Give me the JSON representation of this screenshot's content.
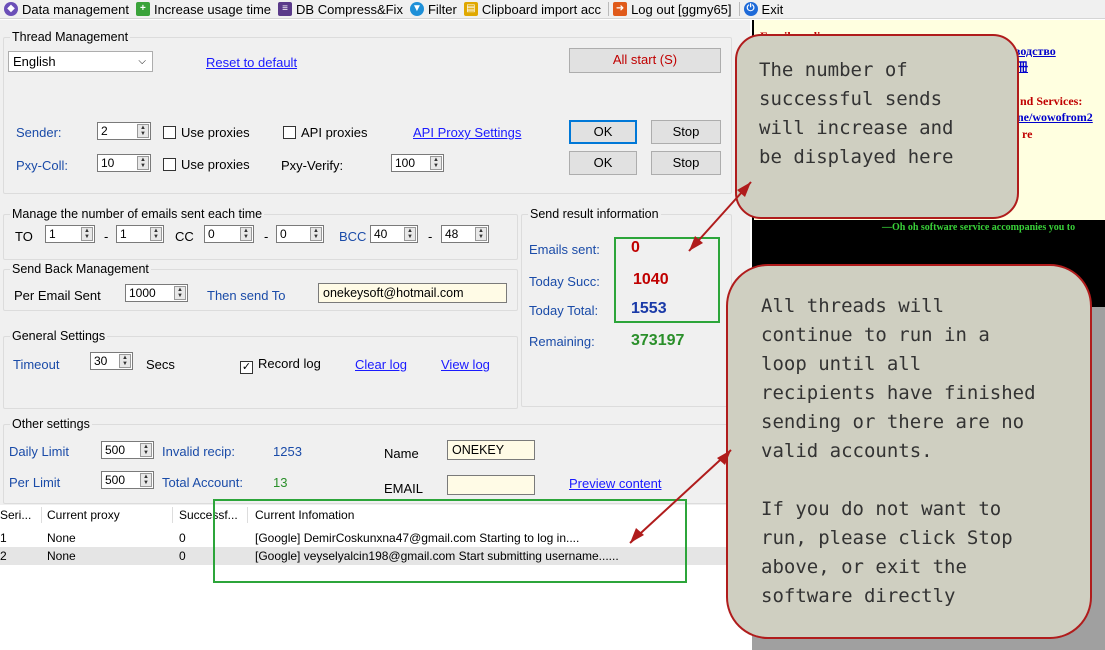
{
  "toolbar": {
    "items": [
      {
        "label": "Data management",
        "icon": "data-management-icon",
        "color": "#6b4fb8"
      },
      {
        "label": "Increase usage time",
        "icon": "add-time-icon",
        "color": "#3aa33a"
      },
      {
        "label": "DB Compress&Fix",
        "icon": "books-icon",
        "color": "#5a3a8a"
      },
      {
        "label": "Filter",
        "icon": "filter-icon",
        "color": "#1e90d8"
      },
      {
        "label": "Clipboard import acc",
        "icon": "clipboard-icon",
        "color": "#e0a800"
      },
      {
        "label": "Log out [ggmy65]",
        "icon": "logout-icon",
        "color": "#e05a1a"
      },
      {
        "label": "Exit",
        "icon": "power-icon",
        "color": "#1e6ad8"
      }
    ]
  },
  "thread": {
    "title": "Thread Management",
    "language": "English",
    "reset": "Reset to default",
    "all_start": "All start (S)",
    "sender_label": "Sender:",
    "sender_value": "2",
    "use_proxies": "Use proxies",
    "api_proxies": "API proxies",
    "api_proxy_settings": "API Proxy Settings",
    "ok": "OK",
    "stop": "Stop",
    "pxy_coll_label": "Pxy-Coll:",
    "pxy_coll_value": "10",
    "pxy_verify_label": "Pxy-Verify:",
    "pxy_verify_value": "100"
  },
  "manage": {
    "title": "Manage the number of emails sent each time",
    "to_label": "TO",
    "to_min": "1",
    "to_max": "1",
    "cc_label": "CC",
    "cc_min": "0",
    "cc_max": "0",
    "bcc_label": "BCC",
    "bcc_min": "40",
    "bcc_max": "48",
    "dash": "-"
  },
  "sendback": {
    "title": "Send Back Management",
    "per_email_label": "Per Email Sent",
    "per_email_value": "1000",
    "then_send": "Then send To",
    "email": "onekeysoft@hotmail.com"
  },
  "general": {
    "title": "General Settings",
    "timeout_label": "Timeout",
    "timeout_value": "30",
    "secs": "Secs",
    "record_log": "Record log",
    "clear_log": "Clear log",
    "view_log": "View log"
  },
  "result": {
    "title": "Send result information",
    "emails_sent_label": "Emails sent:",
    "emails_sent": "0",
    "today_succ_label": "Today Succ:",
    "today_succ": "1040",
    "today_total_label": "Today Total:",
    "today_total": "1553",
    "remaining_label": "Remaining:",
    "remaining": "373197"
  },
  "other": {
    "title": "Other settings",
    "daily_limit_label": "Daily Limit",
    "daily_limit": "500",
    "invalid_recip_label": "Invalid recip:",
    "invalid_recip": "1253",
    "name_label": "Name",
    "name_value": "ONEKEY",
    "per_limit_label": "Per Limit",
    "per_limit": "500",
    "total_account_label": "Total Account:",
    "total_account": "13",
    "email_label": "EMAIL",
    "email_value": "",
    "preview": "Preview content"
  },
  "grid": {
    "columns": [
      "Seri...",
      "Current proxy",
      "Successf...",
      "Current Infomation"
    ],
    "rows": [
      [
        "1",
        "None",
        "0",
        "[Google] DemirCoskunxna47@gmail.com Starting to log in...."
      ],
      [
        "2",
        "None",
        "0",
        "[Google] veyselyalcin198@gmail.com Start submitting username......"
      ]
    ]
  },
  "side": {
    "top_red": "Email sending",
    "link1": "водство",
    "link2": "手冊",
    "services": "nd Services:",
    "link3": "ne/wowofrom2",
    "re": "re",
    "banner": "—Oh oh software service accompanies you to"
  },
  "callouts": {
    "one": "The number of\nsuccessful sends\nwill increase and\nbe displayed here",
    "two": "All threads will\ncontinue to run in a\nloop until all\nrecipients have finished\nsending or there are no\nvalid accounts.\n\nIf you do not want to\nrun, please click Stop\nabove, or exit the\nsoftware directly"
  },
  "colors": {
    "accent_red": "#c00000",
    "accent_green": "#2a8f2a",
    "accent_blue": "#1a3aa8",
    "callout_border": "#b01c1c",
    "highlight_green": "#2ca53a"
  }
}
